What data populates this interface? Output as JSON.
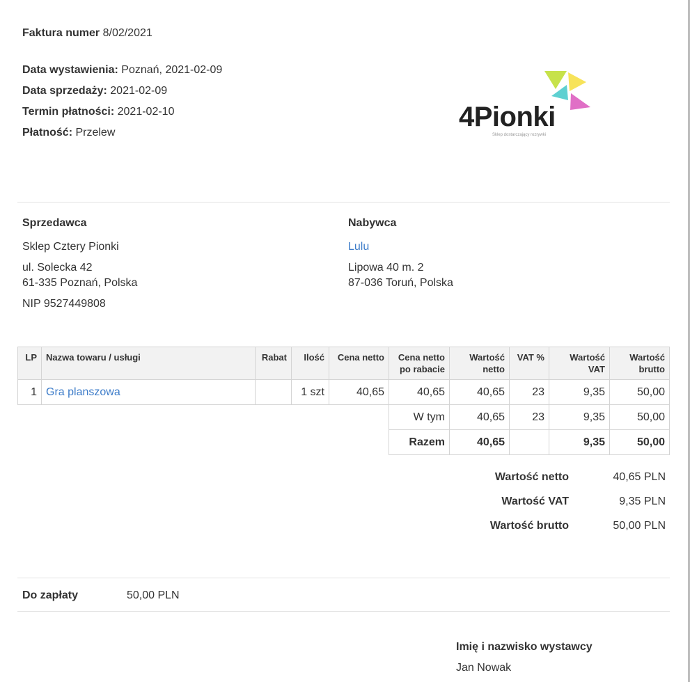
{
  "header": {
    "invoice_label": "Faktura numer",
    "invoice_number": "8/02/2021",
    "issue_date_label": "Data wystawienia:",
    "issue_date_value": "Poznań, 2021-02-09",
    "sale_date_label": "Data sprzedaży:",
    "sale_date_value": "2021-02-09",
    "due_date_label": "Termin płatności:",
    "due_date_value": "2021-02-10",
    "payment_label": "Płatność:",
    "payment_value": "Przelew"
  },
  "logo": {
    "text": "4Pionki",
    "tagline": "Sklep dostarczający rozrywki",
    "colors": [
      "#c7e24b",
      "#f7e35a",
      "#5ed0d1",
      "#e06fc6"
    ]
  },
  "seller": {
    "title": "Sprzedawca",
    "name": "Sklep Cztery Pionki",
    "street": "ul. Solecka 42",
    "city": "61-335 Poznań, Polska",
    "nip": "NIP 9527449808"
  },
  "buyer": {
    "title": "Nabywca",
    "name": "Lulu",
    "street": "Lipowa 40 m. 2",
    "city": "87-036 Toruń, Polska"
  },
  "table": {
    "headers": {
      "lp": "LP",
      "name": "Nazwa towaru / usługi",
      "discount": "Rabat",
      "qty": "Ilość",
      "net_price": "Cena netto",
      "net_price_disc_1": "Cena netto",
      "net_price_disc_2": "po rabacie",
      "net_value_1": "Wartość",
      "net_value_2": "netto",
      "vat_pct": "VAT %",
      "vat_value_1": "Wartość",
      "vat_value_2": "VAT",
      "gross_value_1": "Wartość",
      "gross_value_2": "brutto"
    },
    "rows": [
      {
        "lp": "1",
        "name": "Gra planszowa",
        "discount": "",
        "qty": "1 szt",
        "net_price": "40,65",
        "net_price_disc": "40,65",
        "net_value": "40,65",
        "vat_pct": "23",
        "vat_value": "9,35",
        "gross_value": "50,00"
      }
    ],
    "incl": {
      "label": "W tym",
      "net_value": "40,65",
      "vat_pct": "23",
      "vat_value": "9,35",
      "gross_value": "50,00"
    },
    "total": {
      "label": "Razem",
      "net_value": "40,65",
      "vat_value": "9,35",
      "gross_value": "50,00"
    }
  },
  "summary": {
    "net_label": "Wartość netto",
    "net_value": "40,65 PLN",
    "vat_label": "Wartość VAT",
    "vat_value": "9,35 PLN",
    "gross_label": "Wartość brutto",
    "gross_value": "50,00 PLN"
  },
  "payment_due": {
    "label": "Do zapłaty",
    "value": "50,00 PLN"
  },
  "issuer": {
    "label": "Imię i nazwisko wystawcy",
    "name": "Jan Nowak"
  }
}
